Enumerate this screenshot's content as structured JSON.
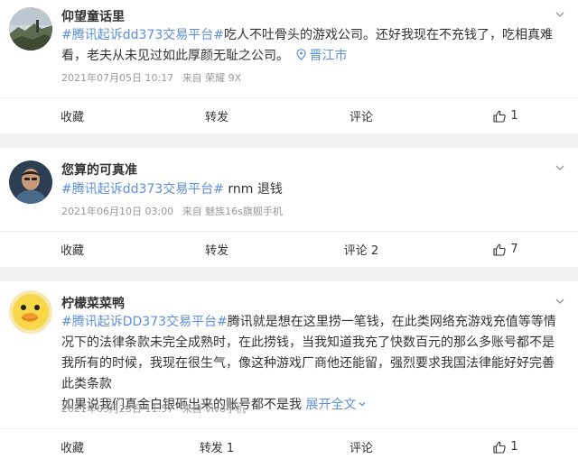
{
  "posts": [
    {
      "username": "仰望童话里",
      "hashtag": "#腾讯起诉dd373交易平台#",
      "body": "吃人不吐骨头的游戏公司。还好我现在不充钱了，吃相真难看，老夫从未见过如此厚颜无耻之公司。",
      "location": "晋江市",
      "date": "2021年07月05日 10:17",
      "source": "来自 荣耀 9X",
      "actions": {
        "favorite": "收藏",
        "repost": "转发",
        "comment": "评论",
        "like_count": "1"
      }
    },
    {
      "username": "您算的可真准",
      "hashtag": "#腾讯起诉dd373交易平台#",
      "body": " rnm 退钱",
      "date": "2021年06月10日 03:00",
      "source": "来自 魅族16s旗舰手机",
      "actions": {
        "favorite": "收藏",
        "repost": "转发",
        "comment": "评论 2",
        "like_count": "7"
      }
    },
    {
      "username": "柠檬菜菜鸭",
      "hashtag": "#腾讯起诉DD373交易平台#",
      "body": "腾讯就是想在这里捞一笔钱，在此类网络充游戏充值等等情况下的法律条款未完全成熟时，在此捞钱，当我知道我充了快数百元的那么多账号都不是我所有的时候，我现在很生气，像这种游戏厂商他还能留，强烈要求我国法律能好好完善此类条款",
      "body2": "如果说我们真金白银砸出来的账号都不是我",
      "expand": "展开全文",
      "date": "2021年05月23日 11:57",
      "source": "来自 vivo手机",
      "actions": {
        "favorite": "收藏",
        "repost": "转发 1",
        "comment": "评论",
        "like_count": "1"
      }
    }
  ],
  "colors": {
    "link": "#5d8fd6",
    "meta": "#999999",
    "divider": "#f2f2f2"
  },
  "icons": {
    "location": "location-pin-icon",
    "like": "thumbs-up-icon",
    "menu": "chevron-down-icon"
  }
}
